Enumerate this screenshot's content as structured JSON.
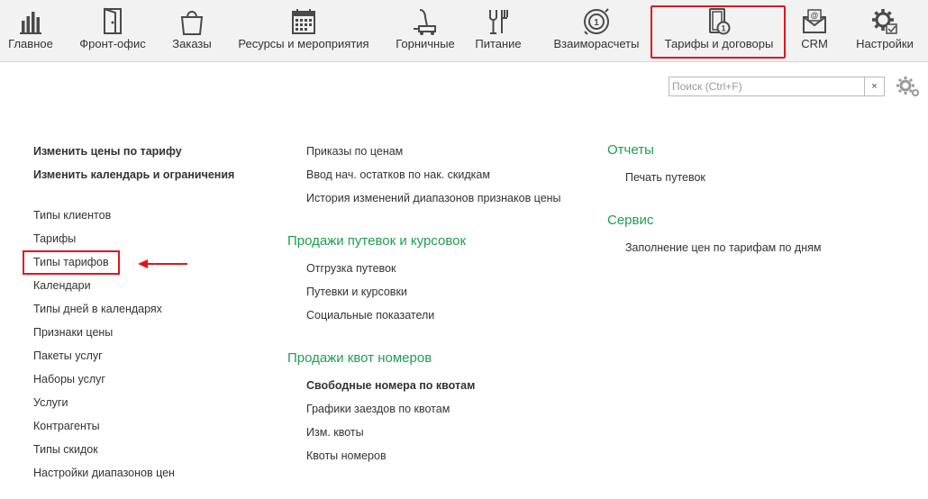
{
  "nav": {
    "items": [
      {
        "label": "Главное",
        "icon": "bar-chart-icon"
      },
      {
        "label": "Фронт-офис",
        "icon": "door-icon"
      },
      {
        "label": "Заказы",
        "icon": "shopping-bag-icon"
      },
      {
        "label": "Ресурсы и мероприятия",
        "icon": "calendar-icon"
      },
      {
        "label": "Горничные",
        "icon": "vacuum-cleaner-icon"
      },
      {
        "label": "Питание",
        "icon": "fork-glass-icon"
      },
      {
        "label": "Взаиморасчеты",
        "icon": "coin-cycle-icon"
      },
      {
        "label": "Тарифы и договоры",
        "icon": "tariff-document-icon"
      },
      {
        "label": "CRM",
        "icon": "email-crm-icon"
      },
      {
        "label": "Настройки",
        "icon": "gear-settings-icon"
      }
    ],
    "active_index": 7
  },
  "search": {
    "placeholder": "Поиск (Ctrl+F)",
    "value": "",
    "clear_label": "×"
  },
  "col1": {
    "items": [
      "Изменить цены по тарифу",
      "Изменить календарь и ограничения",
      "Типы клиентов",
      "Тарифы",
      "Типы тарифов",
      "Календари",
      "Типы дней в календарях",
      "Признаки цены",
      "Пакеты услуг",
      "Наборы услуг",
      "Услуги",
      "Контрагенты",
      "Типы скидок",
      "Настройки диапазонов цен"
    ]
  },
  "col2": {
    "items_top": [
      "Приказы по ценам",
      "Ввод нач. остатков по нак. скидкам",
      "История изменений диапазонов признаков цены"
    ],
    "section_sales_vouchers": "Продажи путевок и курсовок",
    "items_vouchers": [
      "Отгрузка путевок",
      "Путевки и курсовки",
      "Социальные показатели"
    ],
    "section_quota": "Продажи квот номеров",
    "items_quota": [
      "Свободные номера по квотам",
      "Графики заездов по квотам",
      "Изм. квоты",
      "Квоты номеров"
    ]
  },
  "col3": {
    "section_reports": "Отчеты",
    "items_reports": [
      "Печать путевок"
    ],
    "section_service": "Сервис",
    "items_service": [
      "Заполнение цен по тарифам по дням"
    ]
  },
  "colors": {
    "section_title": "#1e9e4f",
    "highlight": "#e3131b",
    "nav_bg": "#f2f2f2"
  }
}
